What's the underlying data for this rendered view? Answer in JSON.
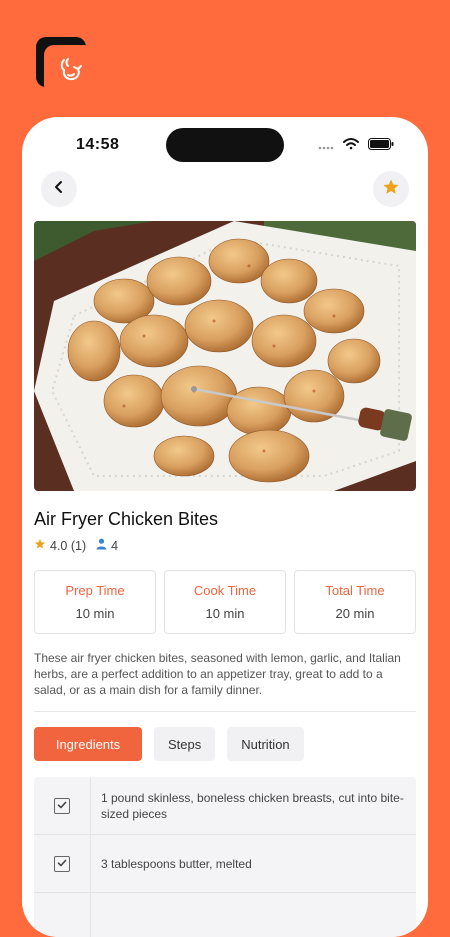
{
  "app": {
    "logo_icon": "rooster-logo-icon",
    "brand_color": "#FF6B3D"
  },
  "status_bar": {
    "time": "14:58"
  },
  "header": {
    "back_icon": "chevron-left-icon",
    "favorite_icon": "star-icon",
    "favorite_color": "#F0A21A"
  },
  "recipe": {
    "title": "Air Fryer Chicken Bites",
    "rating": "4.0 (1)",
    "servings": "4",
    "description": "These air fryer chicken bites, seasoned with lemon, garlic, and Italian herbs, are a perfect addition to an appetizer tray, great to add to a salad, or as a main dish for a family dinner."
  },
  "times": [
    {
      "label": "Prep Time",
      "value": "10 min"
    },
    {
      "label": "Cook Time",
      "value": "10 min"
    },
    {
      "label": "Total Time",
      "value": "20 min"
    }
  ],
  "tabs": [
    {
      "label": "Ingredients",
      "active": true
    },
    {
      "label": "Steps",
      "active": false
    },
    {
      "label": "Nutrition",
      "active": false
    }
  ],
  "ingredients": [
    {
      "text": "1 pound skinless, boneless chicken breasts, cut into bite-sized pieces",
      "checked": true
    },
    {
      "text": "3 tablespoons butter, melted",
      "checked": true
    }
  ]
}
